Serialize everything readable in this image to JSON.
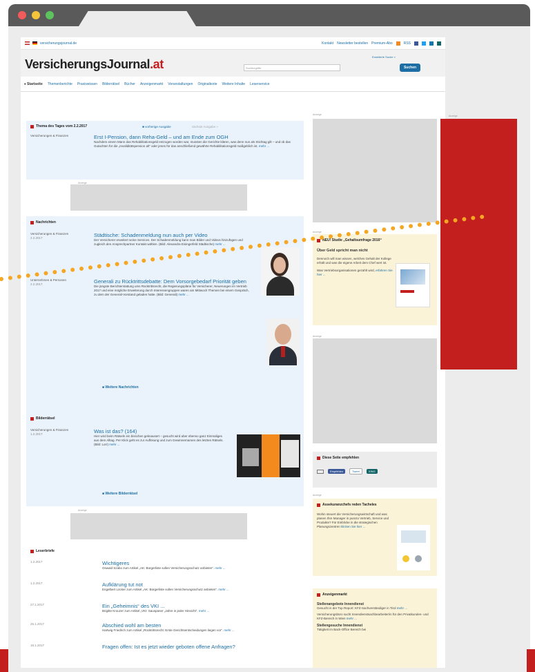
{
  "top": {
    "domain": "versicherungsjournal.de",
    "links": [
      "Kontakt",
      "Newsletter bestellen",
      "Premium-Abo",
      "RSS"
    ]
  },
  "header": {
    "logo_main": "VersicherungsJournal",
    "logo_suffix": ".at",
    "search_placeholder": "Suchbegriffe",
    "search_button": "Suchen",
    "advanced_search": "Erweiterte Suche »"
  },
  "nav": [
    "Startseite",
    "Themenberichte",
    "Praxiswissen",
    "Bilderrätsel",
    "Bücher",
    "Anzeigenmarkt",
    "Veranstaltungen",
    "Originaltexte",
    "Weitere Inhalte",
    "Leserservice"
  ],
  "thema": {
    "title": "Thema des Tages vom 2.2.2017",
    "prev": "vorherige Ausgabe",
    "next": "nächste Ausgabe »",
    "category": "Versicherungen & Finanzen",
    "headline": "Erst I-Pension, dann Reha-Geld – und am Ende zum OGH",
    "text": "Nachdem einem Mann das Rehabilitationsgeld entzogen worden war, mussten die Gerichte klären, was denn nun als Stichtag gilt – und ob das Gutachten für die „Invaliditätspension alt“ oder jenes für das anschließend gewährte Rehabilitationsgeld maßgeblich ist.",
    "more": "mehr ..."
  },
  "news": {
    "title": "Nachrichten",
    "items": [
      {
        "category": "Versicherungen & Finanzen",
        "date": "2.2.2017",
        "headline": "Städtische: Schadenmeldung nun auch per Video",
        "text": "Der Versicherer erweitert seine Services. Der Schadenmeldung kann man Bilder und Videos hinzufügen und zugleich den Ansprechpartner Kontakt wählen. (Bild: Alexandra Eisingerfeld Städtische)",
        "more": "mehr ..."
      },
      {
        "category": "Unternehmen & Personen",
        "date": "2.2.2017",
        "headline": "Generali zu Rücktrittsdebatte: Dem Vorsorgebedarf Priorität geben",
        "text": "Die jüngste Berichterstattung ums Rücktrittsrecht, die Regierungspläne für Versicherer, Neuerungen im Vertrieb 2017 und eine mögliche Erweiterung durch Interessengruppen waren am Mittwoch Themen bei einem Gespräch, zu dem der Generali-Vorstand geladen hatte. (Bild: Generali)",
        "more": "mehr ..."
      }
    ],
    "more_link": "Weitere Nachrichten"
  },
  "riddle": {
    "title": "Bilderrätsel",
    "category": "Versicherungen & Finanzen",
    "date": "1.2.2017",
    "headline": "Was ist das? (164)",
    "text": "Hier wird beim Rätseln ein bisschen geknausert – gesucht wird aber ebenso ganz Einmaliges aus dem Alltag. Per Klick geht es zur Auflösung und zum Gewinnernamen des letzten Rätsels. (Bild: Lorr)",
    "more": "mehr ...",
    "more_link": "Weitere Bilderrätsel"
  },
  "letters": {
    "title": "Leserbriefe",
    "items": [
      {
        "date": "1.2.2017",
        "headline": "Wichtigeres",
        "text": "Oswald Szabo zum Artikel „AK: Bürgerliste sollen Versicherungsschutz anbieten“.",
        "more": "mehr ..."
      },
      {
        "date": "1.2.2017",
        "headline": "Aufklärung tut not",
        "text": "Engelbert Löcker zum Artikel „AK: Bürgerliste sollen Versicherungsschutz anbieten“.",
        "more": "mehr ..."
      },
      {
        "date": "27.1.2017",
        "headline": "Ein „Geheimnis“ des VKI ...",
        "text": "Brigitte Krouzer zum Artikel „VKI: Sauspaner „Jahre in jeder Hinsicht“.",
        "more": "mehr ..."
      },
      {
        "date": "25.1.2017",
        "headline": "Abschied wohl am besten",
        "text": "Hartwig Friedrich zum Artikel „Rücktrittsrecht: Erste Gerichtsentscheidungen liegen vor“.",
        "more": "mehr ..."
      },
      {
        "date": "18.1.2017",
        "headline": "Fragen offen: Ist es jetzt wieder geboten offene Anfragen?",
        "text": "",
        "more": ""
      }
    ]
  },
  "sidebar": {
    "ad_label": "Anzeige",
    "study": {
      "title": "NEU! Studie „Gehaltsumfrage 2016“",
      "subtitle": "Über Geld spricht man nicht",
      "text": "Dennoch will man wissen, welches Gehalt der Kollege erhält und was die eigene Arbeit dem Chef wert ist.",
      "text2": "Was Vertriebsorganisationen gezahlt wird,",
      "more": "erfahren Sie hier ..."
    },
    "recommend": {
      "title": "Diese Seite empfehlen",
      "share": [
        "Empfehlen",
        "Tweet",
        "XING"
      ]
    },
    "future": {
      "title": "Assekuranzchefs reden Tacheles",
      "text": "Wohin steuert die Versicherungswirtschaft und was planen Ihre Manager in puncto Vertrieb, Service und Produkte? Für Einblicke in die strategischen Planungszentren",
      "more": "klicken Sie hier ..."
    },
    "market": {
      "title": "Anzeigenmarkt",
      "sub1": "Stellenangebote Innendienst",
      "line1": "Gesucht in der Top Report: KFZ-Sachverständiger in Tirol",
      "line1more": "mehr ...",
      "line2": "Versicherungsbüro sucht Innendienstsachbearbeiter/in für den Privatkunden- und KFZ-Bereich in Wien",
      "line2more": "mehr ...",
      "sub2": "Stellengesuche Innendienst",
      "line3": "Tätigkeit im Back-Office Bereich bei"
    }
  },
  "colors": {
    "brand_red": "#c41f1f",
    "link_blue": "#1c6ea4",
    "panel_blue": "#eaf3fb",
    "box_yellow": "#fbf3d8",
    "dot_orange": "#f5a623"
  }
}
